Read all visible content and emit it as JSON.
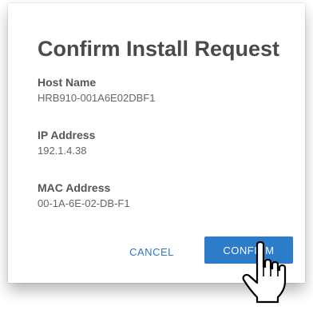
{
  "dialog": {
    "title": "Confirm Install Request",
    "fields": [
      {
        "label": "Host Name",
        "value": "HRB910-001A6E02DBF1"
      },
      {
        "label": "IP Address",
        "value": "192.1.4.38"
      },
      {
        "label": "MAC Address",
        "value": "00-1A-6E-02-DB-F1"
      }
    ],
    "cancel_label": "CANCEL",
    "confirm_label": "CONFIRM"
  },
  "colors": {
    "accent": "#2c7cc9",
    "title_text": "#4a4a4a",
    "link_text": "#2b78c8"
  },
  "icons": {
    "cursor": "pointing-hand-cursor-icon"
  }
}
